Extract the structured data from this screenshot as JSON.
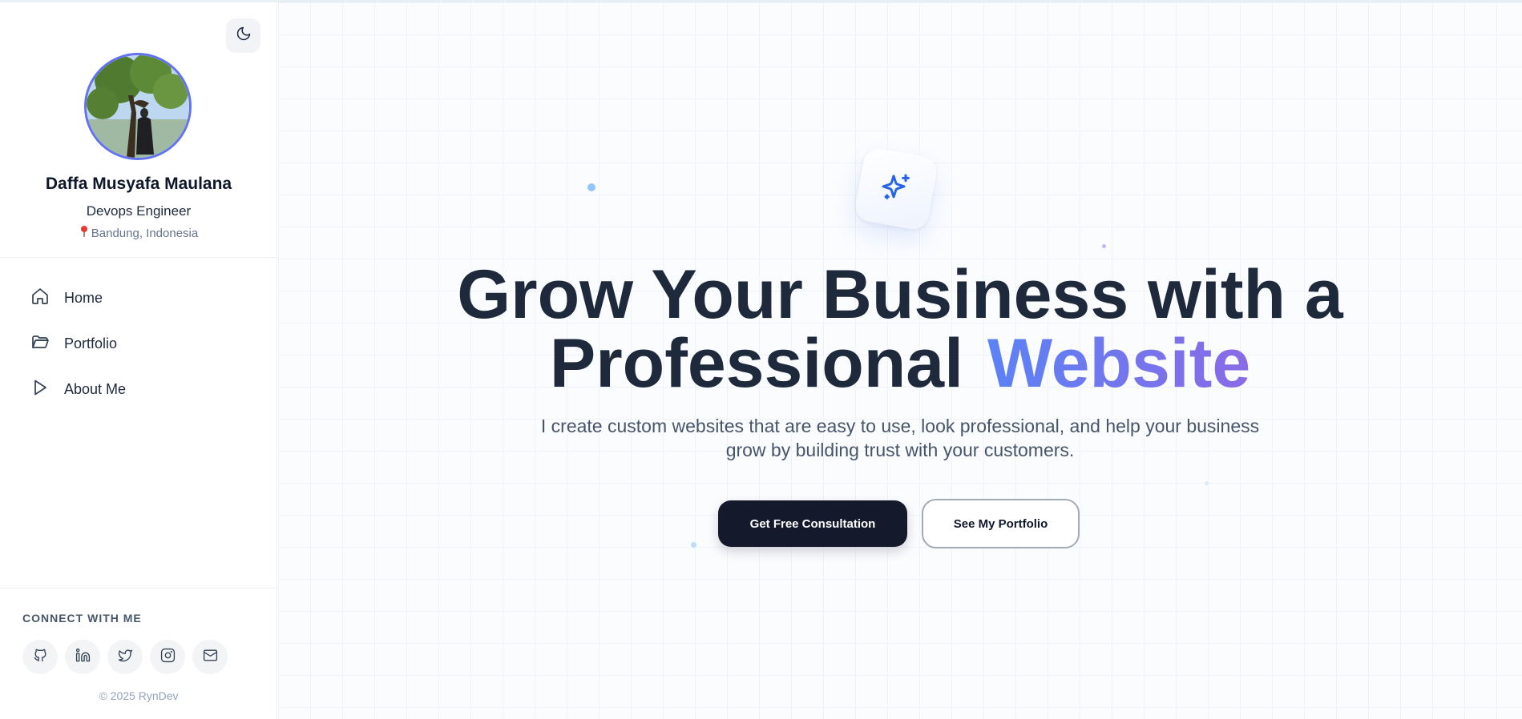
{
  "profile": {
    "name": "Daffa Musyafa Maulana",
    "role": "Devops Engineer",
    "location": "Bandung, Indonesia"
  },
  "nav": {
    "items": [
      {
        "label": "Home",
        "icon": "home-icon"
      },
      {
        "label": "Portfolio",
        "icon": "folder-icon"
      },
      {
        "label": "About Me",
        "icon": "play-icon"
      }
    ]
  },
  "connect": {
    "title": "CONNECT WITH ME",
    "icons": [
      "github-icon",
      "linkedin-icon",
      "twitter-icon",
      "instagram-icon",
      "mail-icon"
    ]
  },
  "footer": {
    "copyright": "© 2025 RynDev"
  },
  "hero": {
    "title_line1": "Grow Your Business with a",
    "title_line2": "Professional",
    "title_accent": "Website",
    "subtitle": "I create custom websites that are easy to use, look professional, and help your business grow by building trust with your customers.",
    "primary_button": "Get Free Consultation",
    "secondary_button": "See My Portfolio"
  },
  "colors": {
    "accent_start": "#5b82f5",
    "accent_end": "#8a6ae6",
    "primary_button_bg": "#141a2b",
    "avatar_ring": "#6272f0"
  }
}
